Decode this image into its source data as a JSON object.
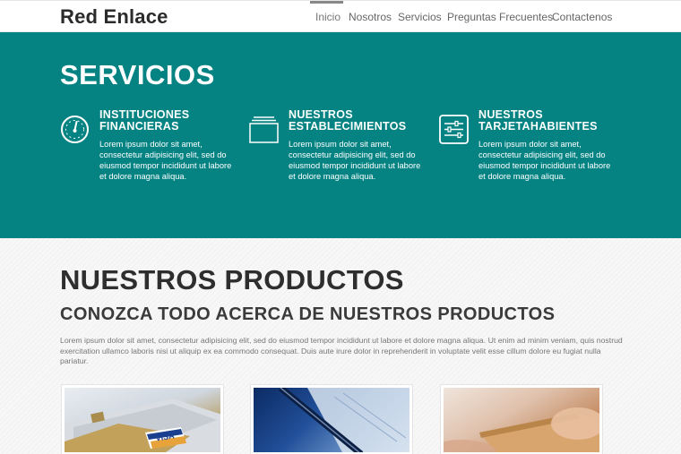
{
  "brand": "Red Enlace",
  "nav": {
    "items": [
      {
        "label": "Inicio",
        "active": true
      },
      {
        "label": "Nosotros",
        "active": false
      },
      {
        "label": "Servicios",
        "active": false
      },
      {
        "label": "Preguntas Frecuentes",
        "active": false
      },
      {
        "label": "Contactenos",
        "active": false
      }
    ]
  },
  "colors": {
    "accent": "#058383",
    "brand_text": "#2b2b2b"
  },
  "services": {
    "title": "SERVICIOS",
    "items": [
      {
        "icon": "gauge-icon",
        "title_line1": "INSTITUCIONES",
        "title_line2": "FINANCIERAS",
        "text": "Lorem ipsum dolor sit amet, consectetur adipisicing elit, sed do eiusmod tempor incididunt ut labore et dolore magna aliqua."
      },
      {
        "icon": "inbox-icon",
        "title_line1": "NUESTROS",
        "title_line2": "ESTABLECIMIENTOS",
        "text": "Lorem ipsum dolor sit amet, consectetur adipisicing elit, sed do eiusmod tempor incididunt ut labore et dolore magna aliqua."
      },
      {
        "icon": "sliders-icon",
        "title_line1": "NUESTROS",
        "title_line2": "TARJETAHABIENTES",
        "text": "Lorem ipsum dolor sit amet, consectetur adipisicing elit, sed do eiusmod tempor incididunt ut labore et dolore magna aliqua."
      }
    ]
  },
  "products": {
    "title": "NUESTROS PRODUCTOS",
    "subtitle": "CONOZCA TODO ACERCA DE NUESTROS PRODUCTOS",
    "text": "Lorem ipsum dolor sit amet, consectetur adipisicing elit, sed do eiusmod tempor incididunt ut labore et dolore magna aliqua. Ut enim ad minim veniam, quis nostrud exercitation ullamco laboris nisi ut aliquip ex ea commodo consequat. Duis aute irure dolor in reprehenderit in voluptate velit esse cillum dolore eu fugiat nulla pariatur.",
    "thumbnails": [
      {
        "icon": "credit-cards-image",
        "card_text": "VISA"
      },
      {
        "icon": "pen-document-image",
        "card_text": ""
      },
      {
        "icon": "card-in-hand-image",
        "card_text": ""
      }
    ]
  }
}
